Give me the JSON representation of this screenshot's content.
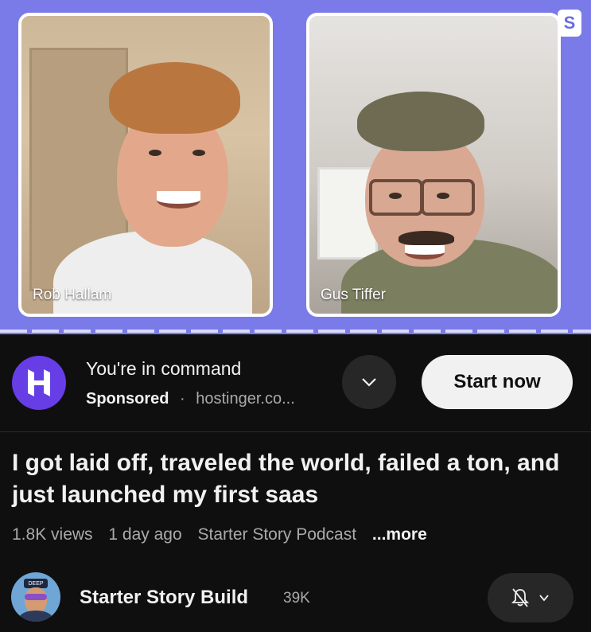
{
  "video": {
    "participants": [
      {
        "name": "Rob Hallam"
      },
      {
        "name": "Gus Tiffer"
      }
    ],
    "badge": "S",
    "colors": {
      "background": "#7a7be8",
      "frame": "#ffffff"
    }
  },
  "ad": {
    "logo_icon": "hostinger-logo",
    "headline": "You're in command",
    "sponsored_label": "Sponsored",
    "separator": "·",
    "domain": "hostinger.co...",
    "cta_label": "Start now",
    "colors": {
      "logo": "#673de6"
    }
  },
  "video_info": {
    "title": "I got laid off, traveled the world, failed a ton, and just launched my first saas",
    "views": "1.8K views",
    "age": "1 day ago",
    "playlist": "Starter Story Podcast",
    "more": "...more"
  },
  "channel": {
    "avatar_text": "DEEP",
    "name": "Starter Story Build",
    "subscribers": "39K",
    "bell_icon": "bell-off-icon",
    "chevron_icon": "chevron-down-icon"
  }
}
